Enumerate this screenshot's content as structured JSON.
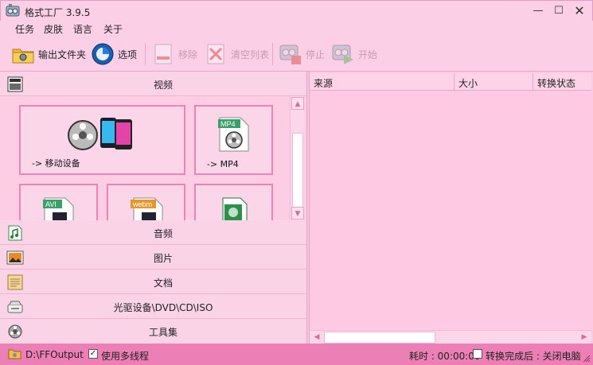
{
  "window": {
    "title": "格式工厂 3.9.5",
    "minimize_glyph": "—",
    "maximize_glyph": "☐",
    "close_glyph": "✕"
  },
  "menu": [
    "任务",
    "皮肤",
    "语言",
    "关于"
  ],
  "toolbar": {
    "output_folder": "输出文件夹",
    "options": "选项",
    "remove": "移除",
    "clear_list": "清空列表",
    "stop": "停止",
    "start": "开始"
  },
  "video_category": {
    "label": "视频",
    "tiles": [
      {
        "label": "-> 移动设备",
        "icon": "mobile-devices-icon"
      },
      {
        "label": "-> MP4",
        "icon": "mp4-icon"
      },
      {
        "label": "",
        "icon": "avi-icon"
      },
      {
        "label": "",
        "icon": "webm-icon"
      },
      {
        "label": "",
        "icon": "video-file-icon"
      }
    ],
    "badges": {
      "mp4": "MP4",
      "avi": "AVI",
      "webm": "webm"
    }
  },
  "categories": [
    {
      "label": "音频",
      "icon": "audio-icon"
    },
    {
      "label": "图片",
      "icon": "picture-icon"
    },
    {
      "label": "文档",
      "icon": "document-icon"
    },
    {
      "label": "光驱设备\\DVD\\CD\\ISO",
      "icon": "optical-drive-icon"
    },
    {
      "label": "工具集",
      "icon": "tools-icon"
    }
  ],
  "task_list": {
    "columns": [
      "来源",
      "大小",
      "转换状态"
    ]
  },
  "status": {
    "output_path": "D:\\FFOutput",
    "multithread_label": "使用多线程",
    "multithread_checked": true,
    "check_glyph": "✓",
    "elapsed": "耗时 : 00:00:00",
    "after_convert": "转换完成后 : 关闭电脑",
    "after_convert_checked": false
  },
  "colors": {
    "accent": "#ec7fb5",
    "tile_border": "#ec82b6",
    "panel_bg": "#fbcfe4"
  }
}
